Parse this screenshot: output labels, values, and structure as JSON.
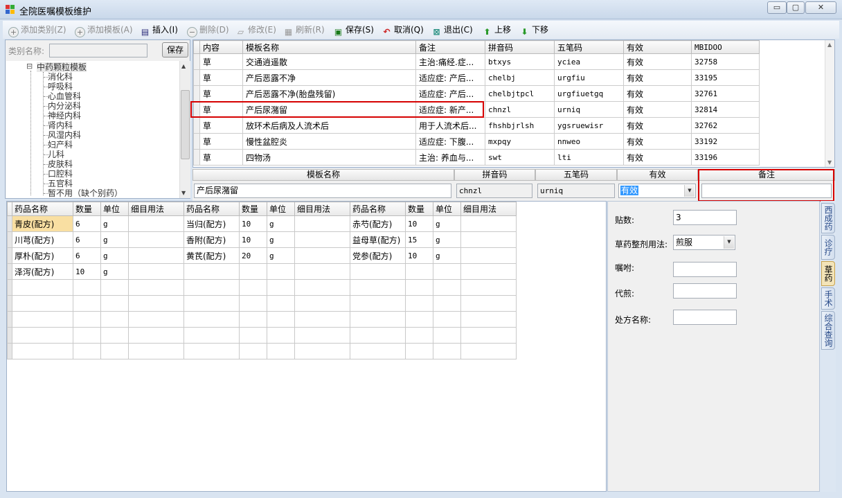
{
  "window": {
    "title": "全院医嘱模板维护",
    "min": "▭",
    "max": "▢",
    "close": "✕"
  },
  "toolbar": [
    {
      "label": "添加类别(Z)",
      "icon": "add-circle-icon",
      "enabled": false
    },
    {
      "label": "添加模板(A)",
      "icon": "add-circle-icon",
      "enabled": false
    },
    {
      "label": "插入(I)",
      "icon": "insert-icon",
      "enabled": true
    },
    {
      "label": "删除(D)",
      "icon": "delete-circle-icon",
      "enabled": false
    },
    {
      "label": "修改(E)",
      "icon": "edit-eraser-icon",
      "enabled": false
    },
    {
      "label": "刷新(R)",
      "icon": "refresh-icon",
      "enabled": false
    },
    {
      "label": "保存(S)",
      "icon": "save-disk-icon",
      "enabled": true
    },
    {
      "label": "取消(Q)",
      "icon": "undo-arrow-icon",
      "enabled": true
    },
    {
      "label": "退出(C)",
      "icon": "exit-box-icon",
      "enabled": true
    },
    {
      "label": "上移",
      "icon": "arrow-up-icon",
      "enabled": true
    },
    {
      "label": "下移",
      "icon": "arrow-down-icon",
      "enabled": true
    }
  ],
  "left": {
    "category_label": "类别名称:",
    "category_value": "",
    "save_label": "保存",
    "tree_root": "中药颗粒模板",
    "tree_toggle": "⊟",
    "tree_items": [
      "消化科",
      "呼吸科",
      "心血管科",
      "内分泌科",
      "神经内科",
      "肾内科",
      "风湿内科",
      "妇产科",
      "儿科",
      "皮肤科",
      "口腔科",
      "五官科",
      "暂不用（缺个别药）"
    ]
  },
  "gridA": {
    "headers": [
      "内容",
      "模板名称",
      "备注",
      "拼音码",
      "五笔码",
      "有效",
      "MBIDOO"
    ],
    "rows": [
      [
        "草",
        "交通逍遥散",
        "主治:痛经.症...",
        "btxys",
        "yciea",
        "有效",
        "32758"
      ],
      [
        "草",
        "产后恶露不净",
        "适应症: 产后...",
        "chelbj",
        "urgfiu",
        "有效",
        "33195"
      ],
      [
        "草",
        "产后恶露不净(胎盘残留)",
        "适应症: 产后...",
        "chelbjtpcl",
        "urgfiuetgq",
        "有效",
        "32761"
      ],
      [
        "草",
        "产后尿潴留",
        "适应症: 新产...",
        "chnzl",
        "urniq",
        "有效",
        "32814"
      ],
      [
        "草",
        "放环术后病及人流术后",
        "用于人流术后...",
        "fhshbjrlsh",
        "ygsruewisr",
        "有效",
        "32762"
      ],
      [
        "草",
        "慢性盆腔炎",
        "适应症: 下腹...",
        "mxpqy",
        "nnweo",
        "有效",
        "33192"
      ],
      [
        "草",
        "四物汤",
        "主治: 养血与...",
        "swt",
        "lti",
        "有效",
        "33196"
      ]
    ]
  },
  "editor": {
    "headers": [
      "模板名称",
      "拼音码",
      "五笔码",
      "有效",
      "备注"
    ],
    "name": "产后尿潴留",
    "pinyin": "chnzl",
    "wubi": "urniq",
    "valid": "有效",
    "note": ""
  },
  "gridB": {
    "headers": [
      "药品名称",
      "数量",
      "单位",
      "细目用法",
      "药品名称",
      "数量",
      "单位",
      "细目用法",
      "药品名称",
      "数量",
      "单位",
      "细目用法"
    ],
    "rows": [
      [
        "青皮(配方)",
        "6",
        "g",
        "",
        "当归(配方)",
        "10",
        "g",
        "",
        "赤芍(配方)",
        "10",
        "g",
        ""
      ],
      [
        "川芎(配方)",
        "6",
        "g",
        "",
        "香附(配方)",
        "10",
        "g",
        "",
        "益母草(配方)",
        "15",
        "g",
        ""
      ],
      [
        "厚朴(配方)",
        "6",
        "g",
        "",
        "黄芪(配方)",
        "20",
        "g",
        "",
        "党参(配方)",
        "10",
        "g",
        ""
      ],
      [
        "泽泻(配方)",
        "10",
        "g",
        "",
        "",
        "",
        "",
        "",
        "",
        "",
        "",
        ""
      ],
      [
        "",
        "",
        "",
        "",
        "",
        "",
        "",
        "",
        "",
        "",
        "",
        ""
      ],
      [
        "",
        "",
        "",
        "",
        "",
        "",
        "",
        "",
        "",
        "",
        "",
        ""
      ],
      [
        "",
        "",
        "",
        "",
        "",
        "",
        "",
        "",
        "",
        "",
        "",
        ""
      ],
      [
        "",
        "",
        "",
        "",
        "",
        "",
        "",
        "",
        "",
        "",
        "",
        ""
      ],
      [
        "",
        "",
        "",
        "",
        "",
        "",
        "",
        "",
        "",
        "",
        "",
        ""
      ]
    ]
  },
  "right": {
    "dose_label": "贴数:",
    "dose": "3",
    "usage_label": "草药整剂用法:",
    "usage": "煎服",
    "advice_label": "嘱咐:",
    "advice": "",
    "decoct_label": "代煎:",
    "decoct": "",
    "rxname_label": "处方名称:",
    "rxname": ""
  },
  "vtabs": [
    "西成药",
    "诊疗",
    "草药",
    "手术",
    "综合查询"
  ]
}
